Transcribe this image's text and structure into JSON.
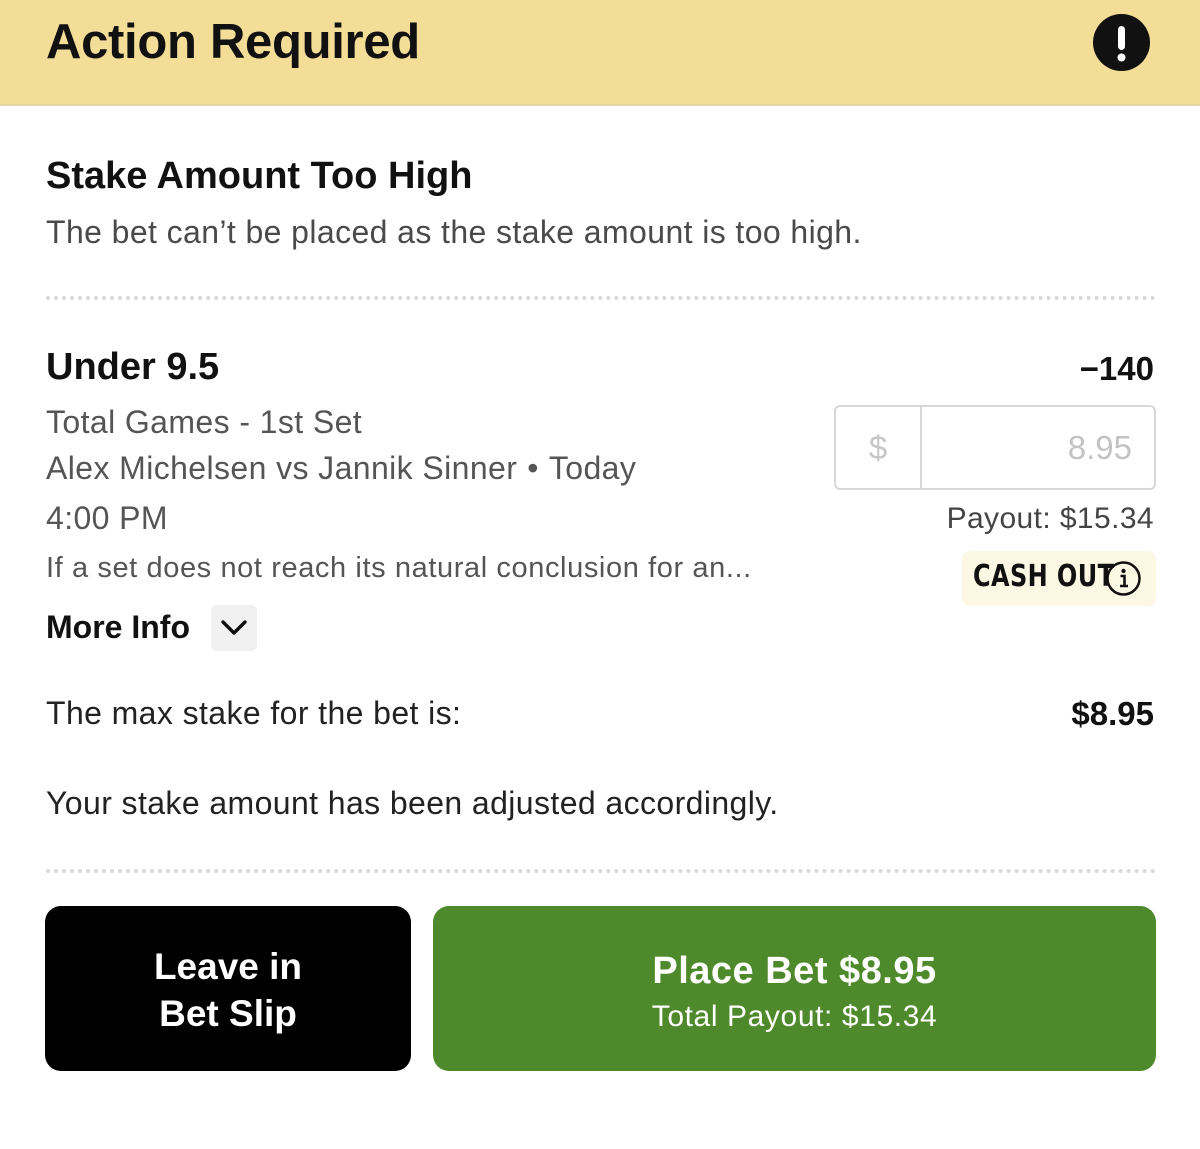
{
  "header": {
    "title": "Action Required",
    "icon": "alert-exclamation-icon"
  },
  "notice": {
    "title": "Stake Amount Too High",
    "message": "The bet can’t be placed as the stake amount is too high."
  },
  "selection": {
    "name": "Under 9.5",
    "odds": "−140",
    "market": "Total Games - 1st Set",
    "event": "Alex Michelsen vs Jannik Sinner",
    "separator": "•",
    "day": "Today",
    "time": "4:00 PM",
    "rule_excerpt": "If a set does not reach its natural conclusion for an...",
    "more_info_label": "More Info"
  },
  "stake": {
    "currency_symbol": "$",
    "value": "8.95",
    "payout": "Payout: $15.34",
    "cash_out_label": "CASH OUT"
  },
  "limits": {
    "max_label": "The max stake for the bet is:",
    "max_value": "$8.95",
    "adjusted_message": "Your stake amount has been adjusted accordingly."
  },
  "actions": {
    "leave_label_line1": "Leave in",
    "leave_label_line2": "Bet Slip",
    "place_label": "Place Bet $8.95",
    "place_sublabel": "Total Payout: $15.34"
  },
  "colors": {
    "header_bg": "#f4dd97",
    "place_button": "#4e8a2b",
    "leave_button": "#000000",
    "cash_out_bg": "#fcf8e3"
  }
}
